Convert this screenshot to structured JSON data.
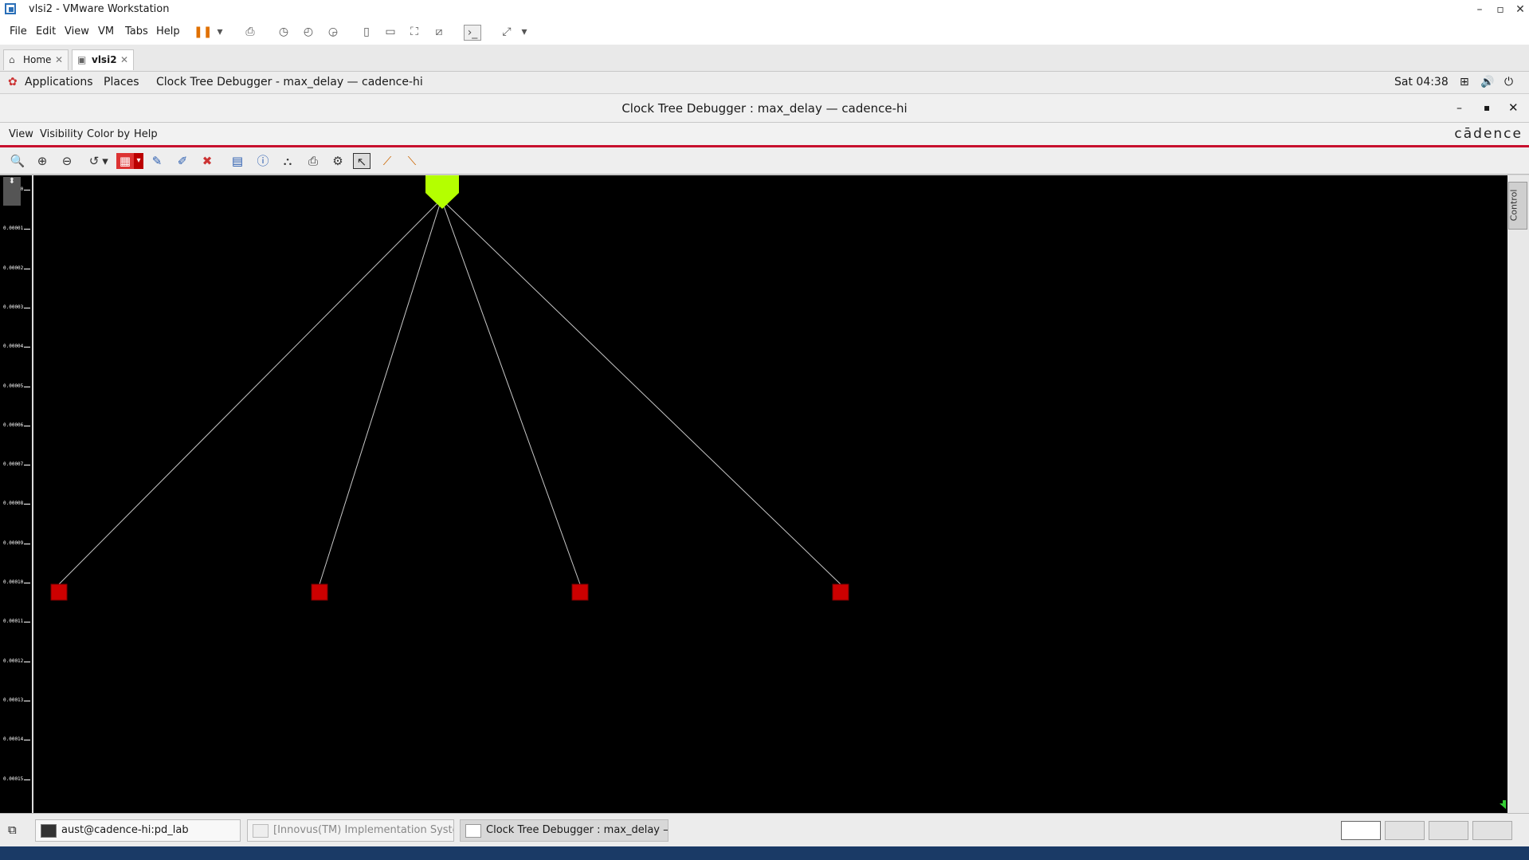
{
  "vmware": {
    "title": "vlsi2 - VMware Workstation",
    "menu": [
      "File",
      "Edit",
      "View",
      "VM",
      "Tabs",
      "Help"
    ],
    "tabs": [
      {
        "label": "Home",
        "icon": "home-icon"
      },
      {
        "label": "vlsi2",
        "icon": "vm-icon"
      }
    ]
  },
  "gnome": {
    "applications": "Applications",
    "places": "Places",
    "window_title": "Clock Tree Debugger - max_delay — cadence-hi",
    "clock": "Sat 04:38"
  },
  "app": {
    "title": "Clock Tree Debugger : max_delay — cadence-hi",
    "menu": [
      "View",
      "Visibility",
      "Color by",
      "Help"
    ],
    "logo": "cādence",
    "control_tab": "Control",
    "ruler_labels": [
      "0.00000",
      "0.00001",
      "0.00002",
      "0.00003",
      "0.00004",
      "0.00005",
      "0.00006",
      "0.00007",
      "0.00008",
      "0.00009",
      "0.00010",
      "0.00011",
      "0.00012",
      "0.00013",
      "0.00014",
      "0.00015"
    ],
    "tree": {
      "root_color": "#b4ff00",
      "sink_color": "#cc0000",
      "edge_color": "#c8c8c8",
      "root": "root-buffer",
      "sinks": [
        "sink-1",
        "sink-2",
        "sink-3",
        "sink-4"
      ]
    }
  },
  "taskbar": {
    "tasks": [
      {
        "label": "aust@cadence-hi:pd_lab",
        "state": "normal"
      },
      {
        "label": "[Innovus(TM) Implementation Syste...",
        "state": "dim"
      },
      {
        "label": "Clock Tree Debugger : max_delay —...",
        "state": "active"
      }
    ]
  }
}
